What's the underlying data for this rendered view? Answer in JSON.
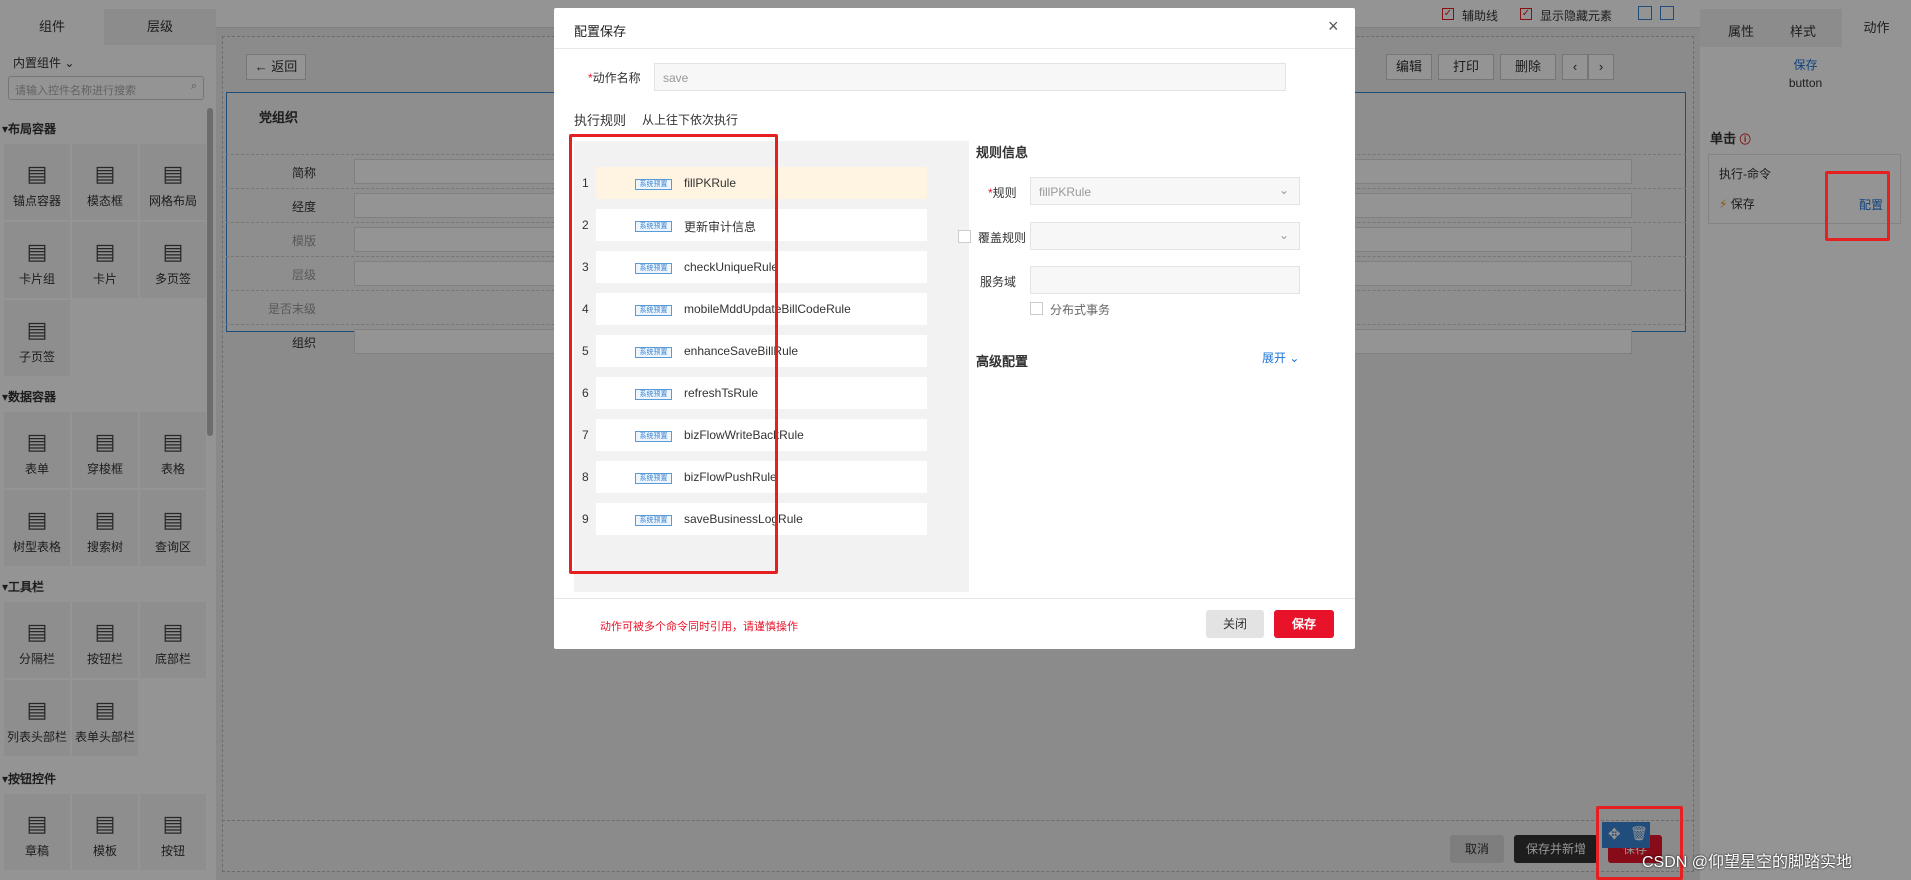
{
  "left": {
    "tabs": [
      "组件",
      "层级"
    ],
    "builtin": "内置组件",
    "search_placeholder": "请输入控件名称进行搜索",
    "sections": [
      {
        "title": "布局容器",
        "items": [
          {
            "label": "锚点容器",
            "icon": "anchor-icon"
          },
          {
            "label": "模态框",
            "icon": "modal-icon"
          },
          {
            "label": "网格布局",
            "icon": "grid-icon"
          },
          {
            "label": "卡片组",
            "icon": "card-group-icon"
          },
          {
            "label": "卡片",
            "icon": "card-icon"
          },
          {
            "label": "多页签",
            "icon": "tabs-icon"
          },
          {
            "label": "子页签",
            "icon": "subtab-icon"
          }
        ]
      },
      {
        "title": "数据容器",
        "items": [
          {
            "label": "表单",
            "icon": "form-icon"
          },
          {
            "label": "穿梭框",
            "icon": "transfer-icon"
          },
          {
            "label": "表格",
            "icon": "table-icon"
          },
          {
            "label": "树型表格",
            "icon": "tree-table-icon"
          },
          {
            "label": "搜索树",
            "icon": "search-tree-icon"
          },
          {
            "label": "查询区",
            "icon": "query-icon"
          }
        ]
      },
      {
        "title": "工具栏",
        "items": [
          {
            "label": "分隔栏",
            "icon": "splitter-icon"
          },
          {
            "label": "按钮栏",
            "icon": "button-bar-icon"
          },
          {
            "label": "底部栏",
            "icon": "footer-bar-icon"
          },
          {
            "label": "列表头部栏",
            "icon": "list-header-icon"
          },
          {
            "label": "表单头部栏",
            "icon": "form-header-icon"
          }
        ]
      },
      {
        "title": "按钮控件",
        "items": [
          {
            "label": "章稿",
            "icon": "btn-draft-icon"
          },
          {
            "label": "模板",
            "icon": "btn-template-icon"
          },
          {
            "label": "按钮",
            "icon": "btn-icon"
          }
        ]
      }
    ]
  },
  "canvas": {
    "back": "返回",
    "toolbar": [
      "编辑",
      "打印",
      "删除"
    ],
    "card_title": "党组织",
    "fields": [
      "简称",
      "经度",
      "模版",
      "层级",
      "是否末级",
      "组织"
    ],
    "footer": {
      "cancel": "取消",
      "save_new": "保存并新增",
      "save": "保存"
    },
    "aux_line": "辅助线",
    "show_hidden": "显示隐藏元素"
  },
  "right": {
    "tabs": [
      "属性",
      "样式",
      "动作"
    ],
    "selected_label": "保存",
    "selected_type": "button",
    "event": "单击",
    "cmd_title": "执行-命令",
    "cmd_item": "保存",
    "config_link": "配置"
  },
  "modal": {
    "title": "配置保存",
    "name_label": "动作名称",
    "name_value": "save",
    "rules_label": "执行规则",
    "rules_hint": "从上往下依次执行",
    "badge": "系统预置",
    "rules": [
      {
        "n": "1",
        "name": "fillPKRule"
      },
      {
        "n": "2",
        "name": "更新审计信息"
      },
      {
        "n": "3",
        "name": "checkUniqueRule"
      },
      {
        "n": "4",
        "name": "mobileMddUpdateBillCodeRule"
      },
      {
        "n": "5",
        "name": "enhanceSaveBillRule"
      },
      {
        "n": "6",
        "name": "refreshTsRule"
      },
      {
        "n": "7",
        "name": "bizFlowWriteBackRule"
      },
      {
        "n": "8",
        "name": "bizFlowPushRule"
      },
      {
        "n": "9",
        "name": "saveBusinessLogRule"
      }
    ],
    "info_title": "规则信息",
    "rule_label": "规则",
    "rule_value": "fillPKRule",
    "override_label": "覆盖规则",
    "domain_label": "服务域",
    "dist_tx": "分布式事务",
    "advanced": "高级配置",
    "expand": "展开",
    "warning": "动作可被多个命令同时引用，请谨慎操作",
    "close_btn": "关闭",
    "save_btn": "保存"
  },
  "watermark": "CSDN @仰望星空的脚踏实地",
  "colors": {
    "primary": "#e8132a",
    "link": "#1a73d9",
    "highlight": "#fff4e2",
    "annotation": "#e52020"
  }
}
